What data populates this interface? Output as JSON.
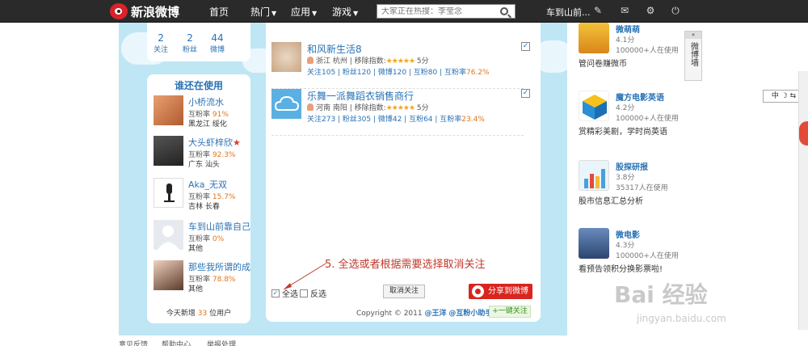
{
  "top_nav": {
    "logo_text": "新浪微博",
    "items": [
      "首页",
      "热门",
      "应用",
      "游戏"
    ],
    "search_placeholder": "大家正在热搜：李莹念",
    "user_link": "车到山前..."
  },
  "profile": {
    "stats": [
      {
        "value": "2",
        "label": "关注"
      },
      {
        "value": "2",
        "label": "粉丝"
      },
      {
        "value": "44",
        "label": "微博"
      }
    ]
  },
  "who_panel": {
    "title": "谁还在使用",
    "users": [
      {
        "name": "小桥流水",
        "rate_label": "互粉率",
        "rate": "91%",
        "location": "黑龙江  绥化"
      },
      {
        "name": "大头虾梓欣",
        "rate_label": "互粉率",
        "rate": "92.3%",
        "location": "广东  汕头"
      },
      {
        "name": "Aka_无双",
        "rate_label": "互粉率",
        "rate": "15.7%",
        "location": "吉林  长春"
      },
      {
        "name": "车到山前靠自己",
        "rate_label": "互粉率",
        "rate": "0%",
        "location": "其他"
      },
      {
        "name": "那些我所谓的成",
        "rate_label": "互粉率",
        "rate": "78.8%",
        "location": "其他"
      }
    ],
    "footer_prefix": "今天新增",
    "footer_count": "33",
    "footer_suffix": "位用户"
  },
  "list": {
    "items": [
      {
        "name": "和风新生活8",
        "location": "浙江  杭州",
        "index_label": "| 移除指数:",
        "stars": "★★★★★",
        "score": "5分",
        "stats": "关注105 | 粉丝120 | 微博120 | 互粉80 | 互粉率",
        "rate": "76.2%"
      },
      {
        "name": "乐舞一派舞蹈衣销售商行",
        "location": "河南  南阳",
        "index_label": "| 移除指数:",
        "stars": "★★★★★",
        "score": "5分",
        "stats": "关注273 | 粉丝305 | 微博42 | 互粉64 | 互粉率",
        "rate": "23.4%"
      }
    ],
    "select_all": "全选",
    "invert": "反选",
    "cancel_button": "取消关注",
    "share_button": "分享到微博",
    "copyright": "Copyright © 2011",
    "author1": "@王洋",
    "author2": "@互粉小助手",
    "follow_button": "+一键关注"
  },
  "annotation": "5. 全选或者根据需要选择取消关注",
  "apps": [
    {
      "name": "微萌萌",
      "score": "4.1分",
      "users": "100000+人在使用",
      "desc": "管问卷赚微币",
      "color": "#e8a51c"
    },
    {
      "name": "魔方电影英语",
      "score": "4.2分",
      "users": "100000+人在使用",
      "desc": "赏精彩美剧，学时尚英语",
      "color": "#2a8fd5"
    },
    {
      "name": "股探研报",
      "score": "3.8分",
      "users": "35317人在使用",
      "desc": "股市信息汇总分析",
      "color": "#4aa0d8"
    },
    {
      "name": "微电影",
      "score": "4.3分",
      "users": "100000+人在使用",
      "desc": "看预告领积分换影票啦!",
      "color": "#3d5f8f"
    }
  ],
  "side_tab": "微博墙",
  "ime": "中 ☽ ⇆",
  "watermark": {
    "brand": "Bai 经验",
    "url": "jingyan.baidu.com"
  },
  "bottom_links": [
    "意见反馈",
    "帮助中心",
    "举报处理"
  ]
}
